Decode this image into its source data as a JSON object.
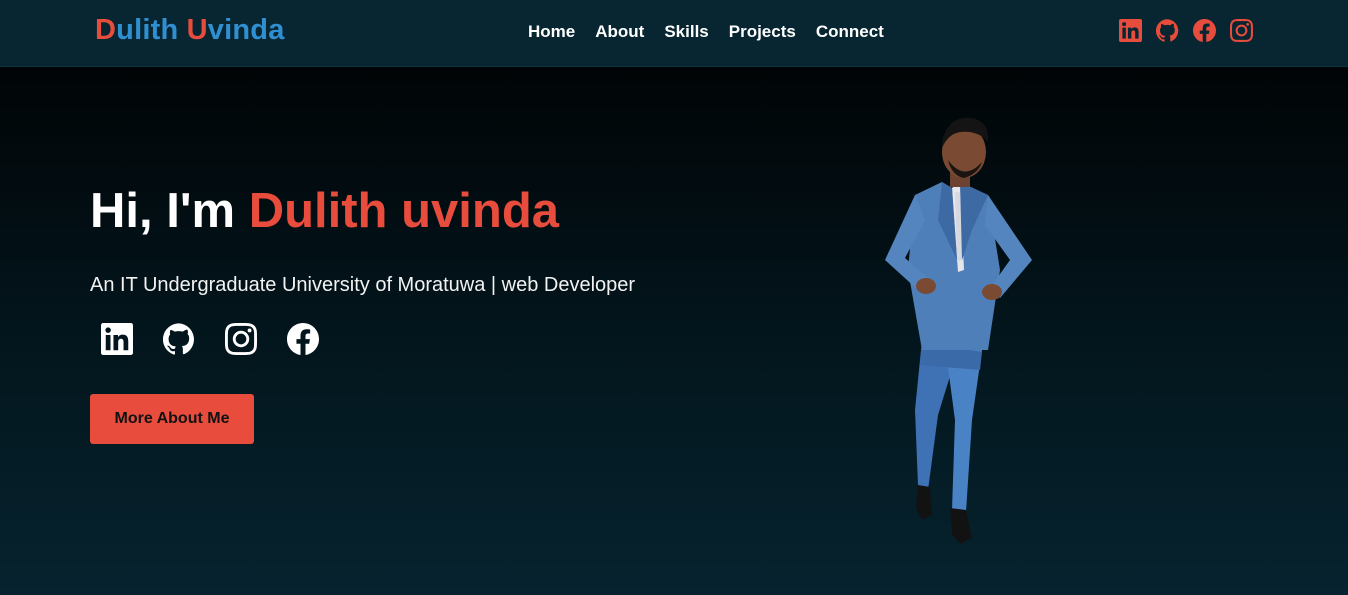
{
  "nav": {
    "brand_first_initial": "D",
    "brand_first_rest": "ulith ",
    "brand_last_initial": "U",
    "brand_last_rest": "vinda",
    "links": [
      "Home",
      "About",
      "Skills",
      "Projects",
      "Connect"
    ],
    "social_icons": [
      "linkedin-icon",
      "github-icon",
      "facebook-icon",
      "instagram-icon"
    ]
  },
  "hero": {
    "greeting": "Hi, I'm ",
    "name": "Dulith uvinda",
    "subtitle": "An IT Undergraduate University of Moratuwa | web Developer",
    "social_icons": [
      "linkedin-icon",
      "github-icon",
      "instagram-icon",
      "facebook-icon"
    ],
    "cta_label": "More About Me"
  },
  "colors": {
    "accent": "#e74c3c",
    "brand_blue": "#2f8fd1",
    "navbar_bg": "#082632",
    "hero_bg_top": "#000000",
    "hero_bg_bottom": "#06232f"
  }
}
